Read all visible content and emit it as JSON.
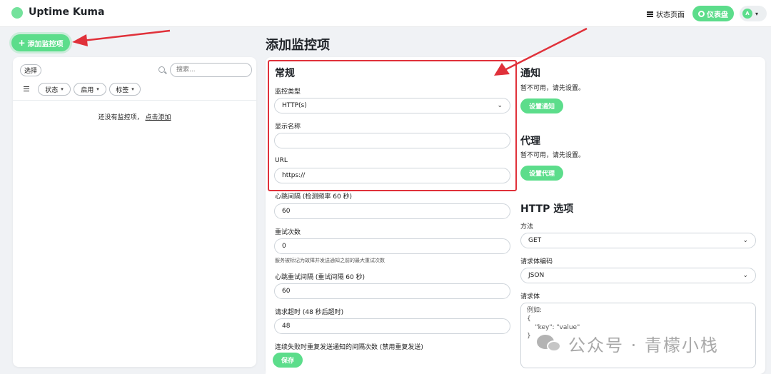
{
  "header": {
    "app_title": "Uptime Kuma",
    "status_page_label": "状态页面",
    "dashboard_label": "仪表盘",
    "avatar_initial": "A",
    "accent_color": "#5cdd8b"
  },
  "sidebar": {
    "add_monitor_label": "添加监控项",
    "select_label": "选择",
    "search_placeholder": "搜索...",
    "filters": [
      "状态",
      "启用",
      "标签"
    ],
    "empty_text": "还没有监控项，",
    "empty_link": "点击添加"
  },
  "main": {
    "page_title": "添加监控项",
    "general": {
      "title": "常规",
      "monitor_type_label": "监控类型",
      "monitor_type_value": "HTTP(s)",
      "display_name_label": "显示名称",
      "display_name_value": "",
      "url_label": "URL",
      "url_value": "https://"
    },
    "heartbeat_interval_label": "心跳间隔 (检测频率 60 秒)",
    "heartbeat_interval_value": "60",
    "retries_label": "重试次数",
    "retries_value": "0",
    "retries_hint": "服务被标记为故障并发送通知之前的最大重试次数",
    "retry_interval_label": "心跳重试间隔 (重试间隔 60 秒)",
    "retry_interval_value": "60",
    "timeout_label": "请求超时 (48 秒后超时)",
    "timeout_value": "48",
    "resend_label": "连续失败时重复发送通知的间隔次数 (禁用重复发送)",
    "save_label": "保存",
    "notifications": {
      "title": "通知",
      "desc": "暂不可用，请先设置。",
      "button": "设置通知"
    },
    "proxy": {
      "title": "代理",
      "desc": "暂不可用，请先设置。",
      "button": "设置代理"
    },
    "http_options": {
      "title": "HTTP 选项",
      "method_label": "方法",
      "method_value": "GET",
      "body_encoding_label": "请求体编码",
      "body_encoding_value": "JSON",
      "body_label": "请求体",
      "body_placeholder": "例如:\n{\n    \"key\": \"value\"\n}"
    }
  },
  "watermark": {
    "text": "公众号 · 青檬小栈"
  },
  "annotation": {
    "color": "#e0313a"
  }
}
